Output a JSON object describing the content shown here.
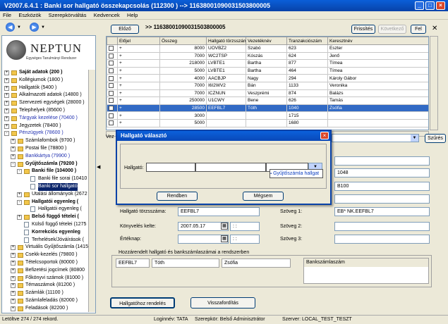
{
  "window": {
    "title": "V2007.6.4.1 : Banki sor hallgató összekapcsolás (112300 ) --> 11638001090031503800005"
  },
  "menu": [
    "File",
    "Eszközök",
    "Szerepkörváltás",
    "Kedvencek",
    "Help"
  ],
  "logo": {
    "name": "NEPTUN",
    "tagline": "Egységes Tanulmányi Rendszer"
  },
  "tree": [
    {
      "label": "Saját adatok (200 )",
      "level": 0,
      "exp": "+",
      "bold": true
    },
    {
      "label": "Kollégiumok (1800 )",
      "level": 0,
      "exp": "+"
    },
    {
      "label": "Hallgatók (5400 )",
      "level": 0,
      "exp": "+"
    },
    {
      "label": "Alkalmazotti adatok (14800 )",
      "level": 0,
      "exp": "+"
    },
    {
      "label": "Szervezeti egységek (28000 )",
      "level": 0,
      "exp": "+"
    },
    {
      "label": "Telephelyek (85600 )",
      "level": 0,
      "exp": "+"
    },
    {
      "label": "Tárgyak kezelése (70400 )",
      "level": 0,
      "exp": "+",
      "blue": true
    },
    {
      "label": "Jegyzetek (78400 )",
      "level": 0,
      "exp": "+"
    },
    {
      "label": "Pénzügyek (78600 )",
      "level": 0,
      "exp": "-",
      "blue": true
    },
    {
      "label": "Számlafombok (9700 )",
      "level": 1,
      "exp": "+"
    },
    {
      "label": "Postai file (78800 )",
      "level": 1,
      "exp": "+"
    },
    {
      "label": "Bankkártya (79900 )",
      "level": 1,
      "exp": "+",
      "blue": true
    },
    {
      "label": "Gyűjtőszámla (79200 )",
      "level": 1,
      "exp": "-",
      "bold": true
    },
    {
      "label": "Banki file (104000 )",
      "level": 2,
      "exp": "-",
      "bold": true
    },
    {
      "label": "Banki file sorai (10410",
      "level": 3,
      "doc": true
    },
    {
      "label": "Banki sor hallgató",
      "level": 3,
      "doc": true,
      "selected": true
    },
    {
      "label": "Utalási állományok (2672",
      "level": 2,
      "exp": "+"
    },
    {
      "label": "Hallgatói egyenleg (",
      "level": 2,
      "exp": "-",
      "bold": true
    },
    {
      "label": "Hallgatói egyenleg (",
      "level": 3,
      "doc": true
    },
    {
      "label": "Belső függő tételei (",
      "level": 2,
      "exp": "+",
      "bold": true
    },
    {
      "label": "Külső függő tételei (1275",
      "level": 2,
      "doc": true
    },
    {
      "label": "Korrekciós egyenleg",
      "level": 2,
      "doc": true,
      "bold": true
    },
    {
      "label": "Terhelések/Jóváírások (",
      "level": 2,
      "doc": true
    },
    {
      "label": "Virtuális Gyűjtőszámla (14150",
      "level": 1,
      "exp": "+"
    },
    {
      "label": "Csekk-kezelés (79800 )",
      "level": 1,
      "exp": "+"
    },
    {
      "label": "Tételcsoportok (80000 )",
      "level": 1,
      "exp": "+"
    },
    {
      "label": "Befizetési jogcímek (80800",
      "level": 1,
      "exp": "+"
    },
    {
      "label": "Főkönyvi számok (81000 )",
      "level": 1,
      "exp": "+"
    },
    {
      "label": "Témaszámok (81200 )",
      "level": 1,
      "exp": "+"
    },
    {
      "label": "Számlák (11100 )",
      "level": 1,
      "exp": "+"
    },
    {
      "label": "Számlafeladás (82000 )",
      "level": 1,
      "exp": "+"
    },
    {
      "label": "Feladások (82200 )",
      "level": 1,
      "exp": "+"
    },
    {
      "label": "Kézi számlarögzítés (273400",
      "level": 1,
      "exp": "+"
    },
    {
      "label": "Házipénztár (274900 )",
      "level": 1,
      "exp": "+"
    }
  ],
  "topbar": {
    "elozo": "Előző",
    "breadcrumb": ">> 11638001090031503800005",
    "frissites": "Frissítés",
    "kovetkezo": "Következő",
    "fel": "Fel"
  },
  "grid": {
    "headers": [
      "",
      "Előjel",
      "Összeg",
      "Hallgató törzsszáma",
      "Vezetéknév",
      "Tranzakciószám",
      "Keresztnév"
    ],
    "rows": [
      [
        "+",
        "8000",
        "UOVBZ2",
        "Szabó",
        "623",
        "Eszter"
      ],
      [
        "+",
        "7000",
        "WC2TSP",
        "Kószás",
        "624",
        "Jenő"
      ],
      [
        "+",
        "218000",
        "LVBTE1",
        "Bartha",
        "877",
        "Tímea"
      ],
      [
        "+",
        "5000",
        "LVBTE1",
        "Bartha",
        "464",
        "Tímea"
      ],
      [
        "+",
        "4000",
        "AACBJP",
        "Nagy",
        "294",
        "Károly Gábor"
      ],
      [
        "+",
        "7000",
        "I6I2WV2",
        "Bán",
        "1133",
        "Veronika"
      ],
      [
        "+",
        "7000",
        "ICZNUN",
        "Veszprémi",
        "874",
        "Balázs"
      ],
      [
        "+",
        "250000",
        "U1CWY",
        "Bene",
        "626",
        "Tamás"
      ],
      [
        "+",
        "28500",
        "EEFBL7",
        "Tóth",
        "1040",
        "Zsófia"
      ],
      [
        "+",
        "3000",
        "",
        "",
        "1715",
        ""
      ],
      [
        "+",
        "5000",
        "",
        "",
        "1680",
        ""
      ]
    ],
    "selected_row": 8
  },
  "filter": {
    "label": "Vez",
    "szures": "Szűrés"
  },
  "detail": {
    "right_fields": [
      "",
      "1048",
      "B100",
      "",
      "EB* NK.EEFBL7"
    ],
    "hallgato_torzsszama_label": "Hallgató törzsszáma:",
    "hallgato_torzsszama": "EEFBL7",
    "szoveg1_label": "Szöveg 1:",
    "szoveg1": "EB* NK.EEFBL7",
    "konyveles_label": "Könyvelés kelte:",
    "konyveles_date": "2007.05.17",
    "konyveles_time": ": :",
    "szoveg2_label": "Szöveg 2:",
    "erteknap_label": "Értéknap:",
    "erteknap_date": "",
    "erteknap_time": ": :",
    "szoveg3_label": "Szöveg 3:",
    "group_title": "Hozzárendelt hallgató és bankszámlaszámai a rendszerben",
    "g_code": "EEFBL7",
    "g_last": "Tóth",
    "g_first": "Zsófia",
    "bankszamla_header": "Bankszámlaszám"
  },
  "buttons": {
    "hallgatohoz": "Hallgatóhoz rendelés",
    "visszaforditas": "Visszafordítás"
  },
  "dialog": {
    "title": "Hallgató választó",
    "hallgato_label": "Hallgató:",
    "dropdown_item": "Gyűjtőszámla hallgat",
    "rendben": "Rendben",
    "megsem": "Mégsem"
  },
  "status": {
    "left": "Letöltve 274 / 274 rekord.",
    "login": "Loginnév: TATA",
    "role": "Szerepkör: Belső Adminisztrátor",
    "server": "Szerver: LOCAL_TEST_TESZT"
  }
}
